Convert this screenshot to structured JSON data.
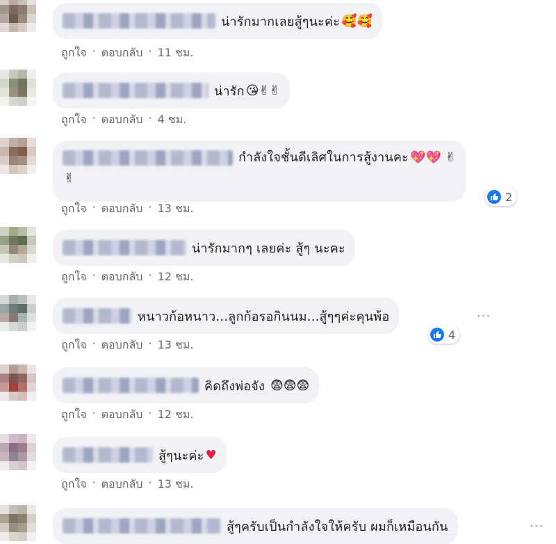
{
  "actions": {
    "like": "ถูกใจ",
    "reply": "ตอบกลับ",
    "dot": "·"
  },
  "comments": [
    {
      "text": "น่ารักมากเลยสู้ๆนะค่ะ",
      "emoji": "🥰🥰",
      "time": "11 ชม."
    },
    {
      "text": "น่ารัก",
      "emoji": "😘✌✌",
      "time": "4 ชม."
    },
    {
      "text": "กำลังใจชั้นดีเลิศในการสู้งานคะ",
      "emoji": "💖💖 ✌",
      "emoji2": "✌",
      "time": "13 ชม.",
      "reactions": "2"
    },
    {
      "text": "น่ารักมากๆ เลยค่ะ สู้ๆ นะคะ",
      "time": "12 ชม."
    },
    {
      "text": "หนาวก้อหนาว...ลูกก้อรอกินนม...สู้ๆๆค่ะคุนพ้อ",
      "time": "13 ชม.",
      "reactions": "4"
    },
    {
      "text": "คิดถึงพ่อจัง",
      "emoji": "😨😨😨",
      "time": "12 ชม."
    },
    {
      "text": "สู้ๆนะค่ะ",
      "emoji": "♥",
      "time": "13 ชม."
    },
    {
      "text": "สู้ๆครับเป็นกำลังใจให้ครับ ผมก็เหมือนกัน"
    }
  ],
  "icons": {
    "like": "thumbs-up-icon",
    "more": "more-options-icon"
  },
  "colors": {
    "bubble": "#f0f2f5",
    "meta": "#65676b",
    "like_blue": "#1877f2",
    "heart": "#e41e3f"
  }
}
